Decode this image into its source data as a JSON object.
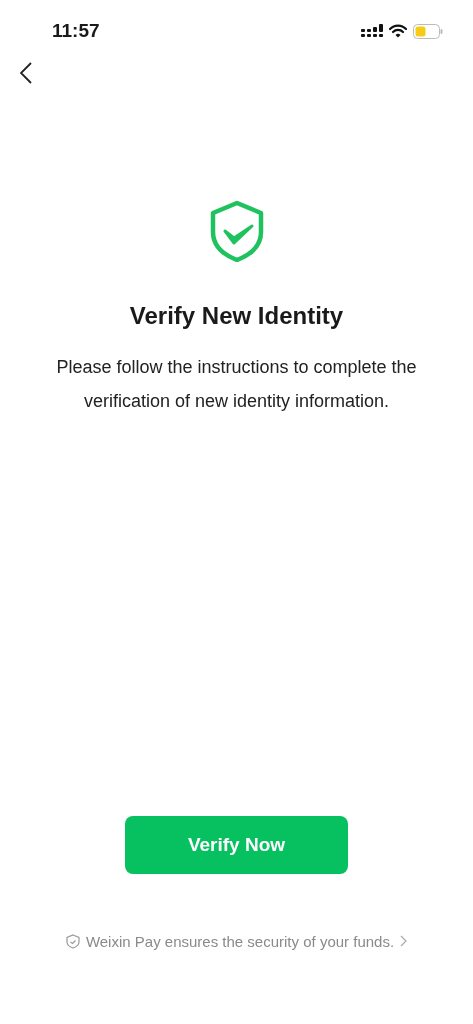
{
  "status_bar": {
    "time": "11:57"
  },
  "page": {
    "title": "Verify New Identity",
    "description": "Please follow the instructions to complete the verification of new identity information."
  },
  "primary_button": {
    "label": "Verify Now"
  },
  "footer": {
    "text": "Weixin Pay ensures the security of your funds."
  }
}
